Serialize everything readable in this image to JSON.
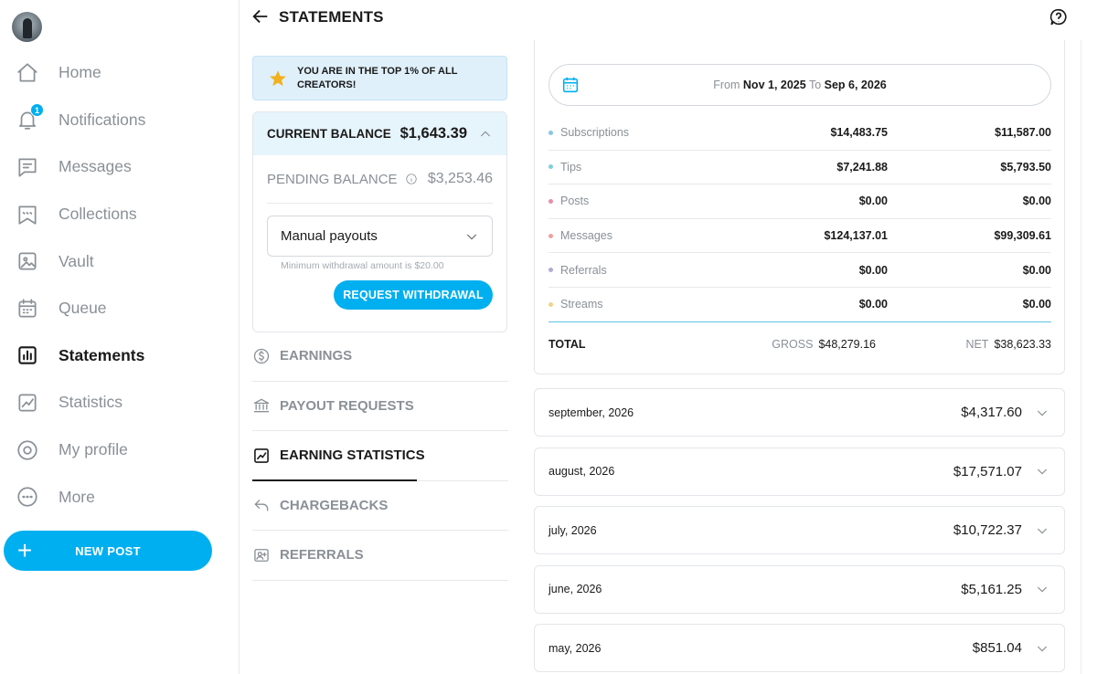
{
  "sidebar": {
    "items": [
      {
        "label": "Home",
        "icon": "home-icon"
      },
      {
        "label": "Notifications",
        "icon": "bell-icon",
        "badge": "1"
      },
      {
        "label": "Messages",
        "icon": "message-icon"
      },
      {
        "label": "Collections",
        "icon": "collections-icon"
      },
      {
        "label": "Vault",
        "icon": "vault-icon"
      },
      {
        "label": "Queue",
        "icon": "calendar-icon"
      },
      {
        "label": "Statements",
        "icon": "bar-chart-icon",
        "active": true
      },
      {
        "label": "Statistics",
        "icon": "trend-chart-icon"
      },
      {
        "label": "My profile",
        "icon": "profile-icon"
      },
      {
        "label": "More",
        "icon": "more-icon"
      }
    ],
    "new_post_label": "NEW POST"
  },
  "header": {
    "title": "STATEMENTS"
  },
  "banner": {
    "text": "YOU ARE IN THE TOP 1% OF ALL CREATORS!"
  },
  "balance": {
    "current_label": "CURRENT BALANCE",
    "current_value": "$1,643.39",
    "pending_label": "PENDING BALANCE",
    "pending_value": "$3,253.46",
    "payout_mode": "Manual payouts",
    "min_note": "Minimum withdrawal amount is $20.00",
    "withdraw_label": "REQUEST WITHDRAWAL"
  },
  "side_menu": [
    {
      "label": "EARNINGS",
      "icon": "dollar-circle-icon"
    },
    {
      "label": "PAYOUT REQUESTS",
      "icon": "bank-icon"
    },
    {
      "label": "EARNING STATISTICS",
      "icon": "trend-chart-icon",
      "active": true
    },
    {
      "label": "CHARGEBACKS",
      "icon": "undo-icon"
    },
    {
      "label": "REFERRALS",
      "icon": "referral-icon"
    }
  ],
  "summary": {
    "date_from_label": "From",
    "date_from": "Nov 1, 2025",
    "date_to_label": "To",
    "date_to": "Sep 6, 2026",
    "rows": [
      {
        "label": "Subscriptions",
        "gross": "$14,483.75",
        "net": "$11,587.00",
        "color": "#86c6e8"
      },
      {
        "label": "Tips",
        "gross": "$7,241.88",
        "net": "$5,793.50",
        "color": "#7fd0dc"
      },
      {
        "label": "Posts",
        "gross": "$0.00",
        "net": "$0.00",
        "color": "#e88ea6"
      },
      {
        "label": "Messages",
        "gross": "$124,137.01",
        "net": "$99,309.61",
        "color": "#f0a0a0"
      },
      {
        "label": "Referrals",
        "gross": "$0.00",
        "net": "$0.00",
        "color": "#b3a9d6"
      },
      {
        "label": "Streams",
        "gross": "$0.00",
        "net": "$0.00",
        "color": "#f3d28a"
      }
    ],
    "total_label": "TOTAL",
    "gross_tag": "GROSS",
    "gross_total": "$48,279.16",
    "net_tag": "NET",
    "net_total": "$38,623.33"
  },
  "months": [
    {
      "label": "september, 2026",
      "value": "$4,317.60"
    },
    {
      "label": "august, 2026",
      "value": "$17,571.07"
    },
    {
      "label": "july, 2026",
      "value": "$10,722.37"
    },
    {
      "label": "june, 2026",
      "value": "$5,161.25"
    },
    {
      "label": "may, 2026",
      "value": "$851.04"
    }
  ],
  "colors": {
    "accent": "#00aff0",
    "banner_bg": "#dff0fa",
    "muted": "#8a9096"
  }
}
